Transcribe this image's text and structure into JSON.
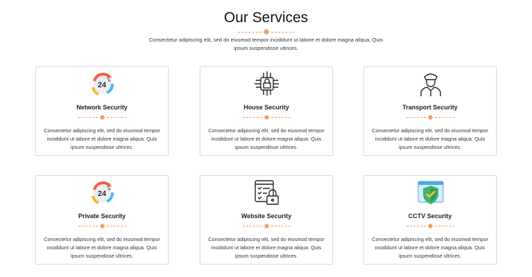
{
  "header": {
    "title": "Our Services",
    "subtitle": "Consectetur adipiscing elit, sed do eiusmod tempor incididunt ut labore et dolore magna aliqua. Quis ipsum suspendisse ultrices."
  },
  "accent": "#f39a5c",
  "services": [
    {
      "title": "Network Security",
      "icon": "24h-icon",
      "text": "Consectetur adipiscing elit, sed do eiusmod tempor incididunt ut labore et dolore magna aliqua. Quis ipsum suspendisse ultrices."
    },
    {
      "title": "House Security",
      "icon": "circuit-lock-icon",
      "text": "Consectetur adipiscing elit, sed do eiusmod tempor incididunt ut labore et dolore magna aliqua. Quis ipsum suspendisse ultrices."
    },
    {
      "title": "Transport Security",
      "icon": "security-guard-icon",
      "text": "Consectetur adipiscing elit, sed do eiusmod tempor incididunt ut labore et dolore magna aliqua. Quis ipsum suspendisse ultrices."
    },
    {
      "title": "Private Security",
      "icon": "24h-icon",
      "text": "Consectetur adipiscing elit, sed do eiusmod tempor incididunt ut labore et dolore magna aliqua. Quis ipsum suspendisse ultrices."
    },
    {
      "title": "Website Security",
      "icon": "checklist-lock-icon",
      "text": "Consectetur adipiscing elit, sed do eiusmod tempor incididunt ut labore et dolore magna aliqua. Quis ipsum suspendisse ultrices."
    },
    {
      "title": "CCTV Security",
      "icon": "shield-check-icon",
      "text": "Consectetur adipiscing elit, sed do eiusmod tempor incididunt ut labore et dolore magna aliqua. Quis ipsum suspendisse ultrices."
    }
  ],
  "icon_label": "24h"
}
